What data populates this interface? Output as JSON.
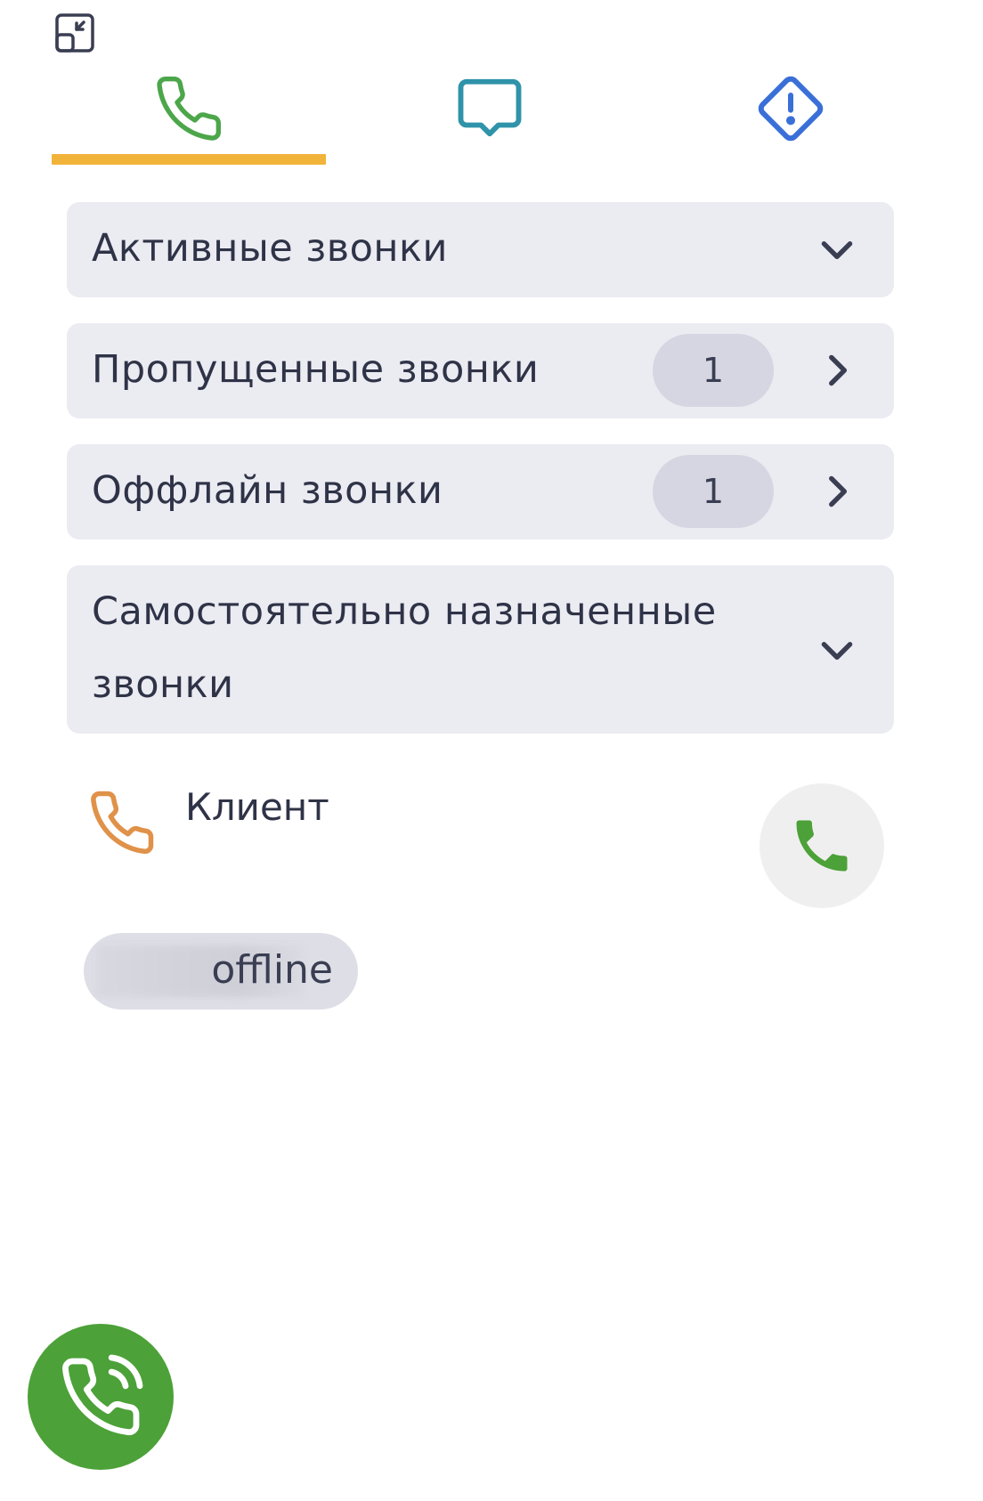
{
  "header": {
    "minimize_icon": "minimize-window-icon"
  },
  "tabs": [
    {
      "icon": "phone-icon",
      "color": "#4ca64a",
      "active": true
    },
    {
      "icon": "chat-bubble-icon",
      "color": "#2f93a9",
      "active": false
    },
    {
      "icon": "alert-diamond-icon",
      "color": "#3a6fd8",
      "active": false
    }
  ],
  "colors": {
    "tab_underline": "#f2b33b",
    "section_background": "#ebebf2",
    "badge_background": "#d5d6e1",
    "incoming_call_icon": "#e0924a",
    "accept_call_green": "#4ca138"
  },
  "sections": [
    {
      "title": "Активные звонки",
      "badge": null,
      "chevron": "chevron-down-icon"
    },
    {
      "title": "Пропущенные звонки",
      "badge": "1",
      "chevron": "chevron-right-icon"
    },
    {
      "title": "Оффлайн звонки",
      "badge": "1",
      "chevron": "chevron-right-icon"
    },
    {
      "title": "Самостоятельно назначенные звонки",
      "badge": null,
      "chevron": "chevron-down-icon"
    }
  ],
  "call": {
    "name": "Клиент",
    "icon": "phone-icon",
    "action_icon": "phone-icon"
  },
  "status": {
    "label": "offline"
  },
  "fab": {
    "icon": "phone-ringing-icon"
  }
}
